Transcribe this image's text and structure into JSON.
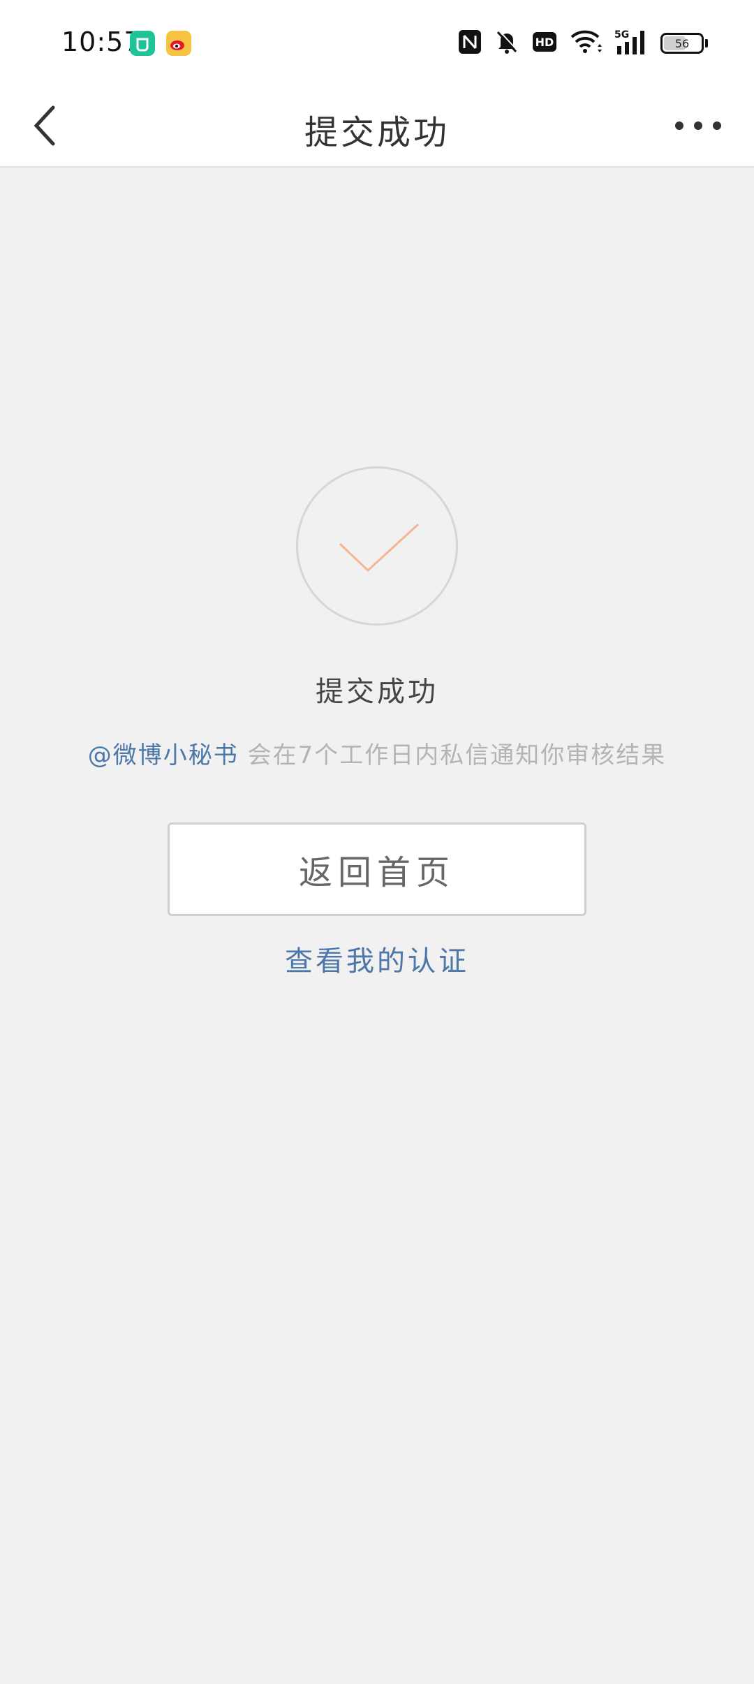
{
  "status_bar": {
    "time": "10:57",
    "battery_level": "56",
    "network_label": "5G",
    "hd_label": "HD",
    "icons": [
      "mi-home-icon",
      "weibo-icon",
      "nfc-icon",
      "bell-off-icon",
      "hd-icon",
      "wifi-icon",
      "signal-icon",
      "battery-icon"
    ]
  },
  "nav": {
    "title": "提交成功",
    "back_icon": "chevron-left-icon",
    "more_icon": "more-dots-icon"
  },
  "main": {
    "success_title": "提交成功",
    "notice_mention": "@微博小秘书",
    "notice_text": " 会在7个工作日内私信通知你审核结果",
    "home_button_label": "返回首页",
    "view_cert_link": "查看我的认证"
  },
  "colors": {
    "accent_link": "#4c77a8",
    "check_mark": "#f5b58f",
    "background": "#f1f1f1"
  }
}
